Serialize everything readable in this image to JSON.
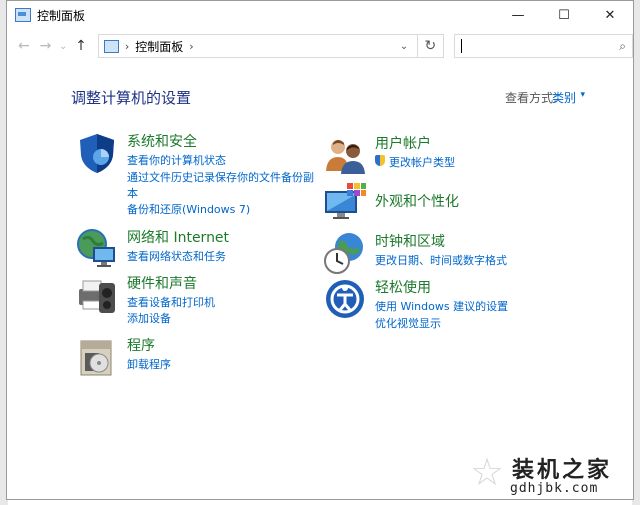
{
  "window": {
    "title": "控制面板",
    "controls": {
      "minimize": "—",
      "maximize": "☐",
      "close": "✕"
    }
  },
  "navbar": {
    "back": "←",
    "forward": "→",
    "recent": "⌄",
    "up": "↑",
    "address_path": "控制面板",
    "address_sep": "›",
    "address_sep2": "›",
    "dropdown": "⌄",
    "refresh": "↻",
    "search_placeholder": "",
    "search_icon": "⌕"
  },
  "main": {
    "heading": "调整计算机的设置",
    "view_by_label": "查看方式:",
    "view_by_value": "类别",
    "view_by_arrow": "▾"
  },
  "categories": {
    "system_security": {
      "title": "系统和安全",
      "icon": "shield-icon",
      "links": [
        "查看你的计算机状态",
        "通过文件历史记录保存你的文件备份副",
        "本",
        "备份和还原(Windows 7)"
      ]
    },
    "network": {
      "title": "网络和 Internet",
      "icon": "network-globe-icon",
      "links": [
        "查看网络状态和任务"
      ]
    },
    "hardware_sound": {
      "title": "硬件和声音",
      "icon": "printer-icon",
      "links": [
        "查看设备和打印机",
        "添加设备"
      ]
    },
    "programs": {
      "title": "程序",
      "icon": "programs-box-icon",
      "links": [
        "卸载程序"
      ]
    },
    "user_accounts": {
      "title": "用户帐户",
      "icon": "users-icon",
      "links": [
        "更改帐户类型"
      ]
    },
    "appearance": {
      "title": "外观和个性化",
      "icon": "monitor-palette-icon",
      "links": []
    },
    "clock_region": {
      "title": "时钟和区域",
      "icon": "clock-globe-icon",
      "links": [
        "更改日期、时间或数字格式"
      ]
    },
    "ease_access": {
      "title": "轻松使用",
      "icon": "ease-of-access-icon",
      "links": [
        "使用 Windows 建议的设置",
        "优化视觉显示"
      ]
    }
  },
  "watermark": {
    "title": "装机之家",
    "url": "gdhjbk.com"
  }
}
